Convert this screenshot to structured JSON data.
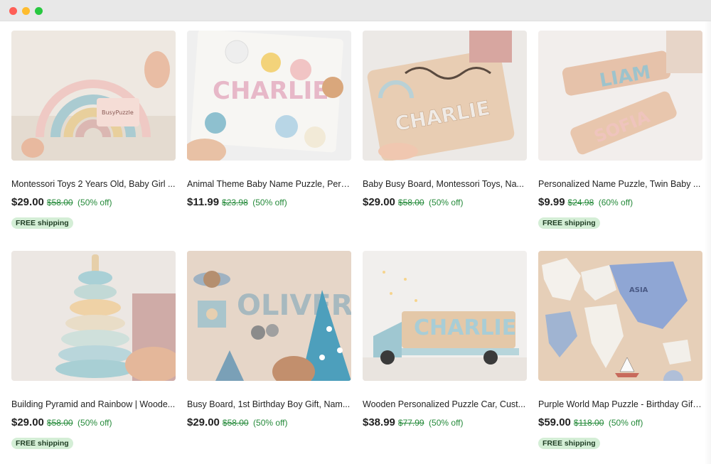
{
  "products": [
    {
      "title": "Montessori Toys 2 Years Old, Baby Girl ...",
      "price": "$29.00",
      "original": "$58.00",
      "discount": "(50% off)",
      "shipping": "FREE shipping",
      "image_label": "BusyPuzzle"
    },
    {
      "title": "Animal Theme Baby Name Puzzle, Pers...",
      "price": "$11.99",
      "original": "$23.98",
      "discount": "(50% off)",
      "shipping": "",
      "image_label": "CHARLIE"
    },
    {
      "title": "Baby Busy Board, Montessori Toys, Na...",
      "price": "$29.00",
      "original": "$58.00",
      "discount": "(50% off)",
      "shipping": "",
      "image_label": "CHARLIE"
    },
    {
      "title": "Personalized Name Puzzle, Twin Baby ...",
      "price": "$9.99",
      "original": "$24.98",
      "discount": "(60% off)",
      "shipping": "FREE shipping",
      "image_label": "LIAM",
      "image_label2": "SOFIA"
    },
    {
      "title": "Building Pyramid and Rainbow | Woode...",
      "price": "$29.00",
      "original": "$58.00",
      "discount": "(50% off)",
      "shipping": "FREE shipping"
    },
    {
      "title": "Busy Board, 1st Birthday Boy Gift, Nam...",
      "price": "$29.00",
      "original": "$58.00",
      "discount": "(50% off)",
      "shipping": "",
      "image_label": "OLIVER"
    },
    {
      "title": "Wooden Personalized Puzzle Car, Cust...",
      "price": "$38.99",
      "original": "$77.99",
      "discount": "(50% off)",
      "shipping": "",
      "image_label": "CHARLIE"
    },
    {
      "title": "Purple World Map Puzzle - Birthday Gift...",
      "price": "$59.00",
      "original": "$118.00",
      "discount": "(50% off)",
      "shipping": "FREE shipping",
      "image_label": "ASIA"
    }
  ]
}
